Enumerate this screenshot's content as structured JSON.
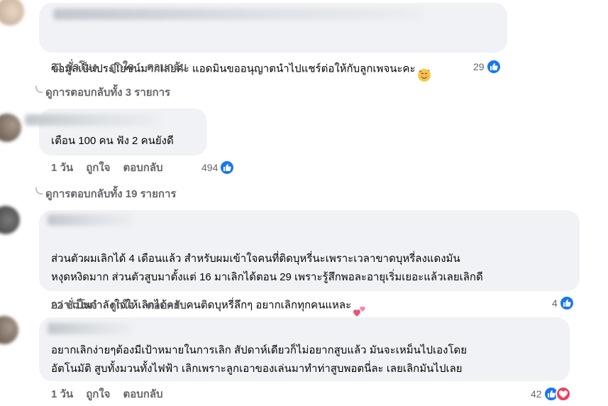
{
  "comments": [
    {
      "text": "ข้อมูลเป็นประโยชน์มากเลยค่ะ แอดมินขออนุญาตนำไปแชร์ต่อให้กับลูกเพจนะคะ",
      "emoji": "smiling-face-with-hearts-emoji",
      "time": "21 ชั่วโมง",
      "like_label": "ถูกใจ",
      "reply_label": "ตอบกลับ",
      "reaction_count": "29",
      "reactions": [
        "like-icon"
      ],
      "view_replies": "ดูการตอบกลับทั้ง 3 รายการ"
    },
    {
      "text": "เตือน 100 คน ฟัง 2 คนยังดี",
      "time": "1 วัน",
      "like_label": "ถูกใจ",
      "reply_label": "ตอบกลับ",
      "reaction_count": "494",
      "reactions": [
        "like-icon"
      ],
      "view_replies": "ดูการตอบกลับทั้ง 19 รายการ"
    },
    {
      "text": "ส่วนตัวผมเลิกได้ 4 เดือนแล้ว สำหรับผมเข้าใจคนที่ติดบุหรี่นะเพราะเวลาขาดบุหรี่ลงแดงมัน\nหงุดหงิดมาก ส่วนตัวสูบมาตั้งแต่ 16 มาเลิกได้ตอน 29 เพราะรู้สึกพอละอายุเริ่มเยอะแล้วเลยเลิกดี\nกว่า เป็นกำลังใจให้เลิกได้ครับคนติดบุหรี่ลึกๆ อยากเลิกทุกคนแหละ",
      "emoji": "two-hearts-emoji",
      "time": "22 ชั่วโมง",
      "like_label": "ถูกใจ",
      "reply_label": "ตอบกลับ",
      "reaction_count": "4",
      "reactions": [
        "like-icon"
      ]
    },
    {
      "text": "อยากเลิกง่ายๆต้องมีเป้าหมายในการเลิก สัปดาห์เดียวก็ไม่อยากสูบแล้ว มันจะเหม็นไปเองโดย\nอัตโนมัติ สูบทั้งมวนทั้งไฟฟ้า เลิกเพราะลูกเอาของเล่นมาทำท่าสูบพอตนี่ละ เลยเลิกมันไปเลย",
      "time": "1 วัน",
      "like_label": "ถูกใจ",
      "reply_label": "ตอบกลับ",
      "reaction_count": "42",
      "reactions": [
        "like-icon",
        "love-icon"
      ]
    }
  ],
  "colors": {
    "bubble": "#f0f2f5",
    "meta": "#65676b",
    "like": "#1877f2",
    "love": "#f33e58"
  }
}
